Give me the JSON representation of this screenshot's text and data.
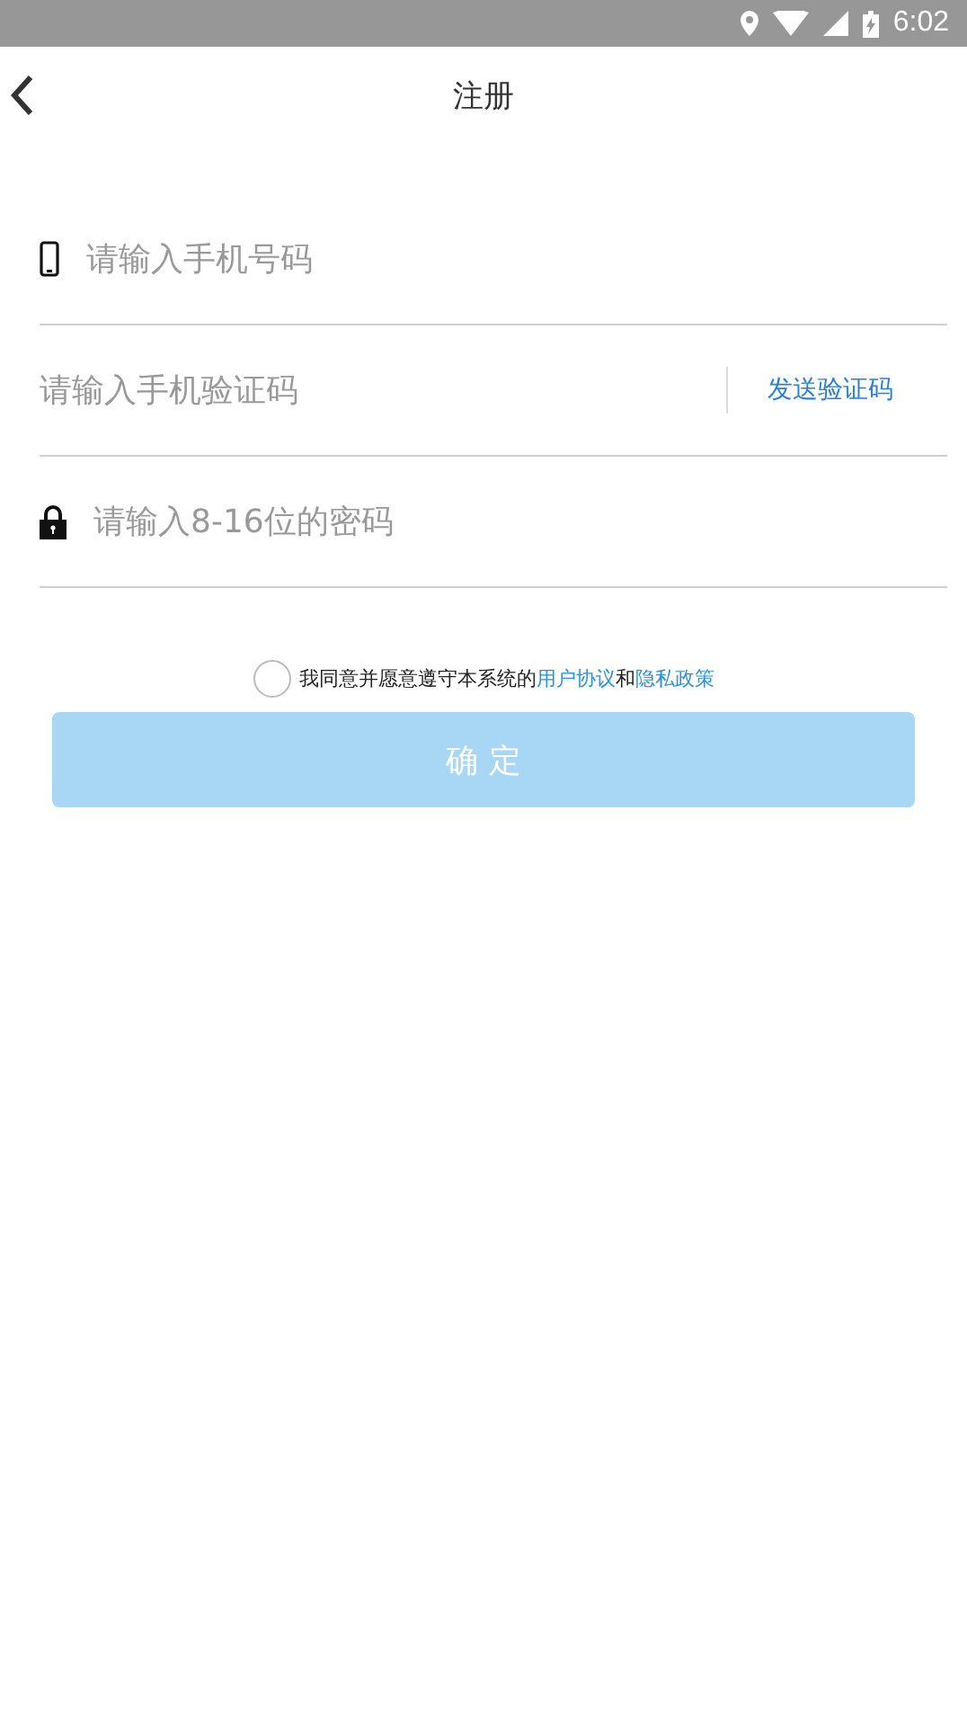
{
  "status_bar": {
    "time": "6:02"
  },
  "header": {
    "title": "注册"
  },
  "fields": [
    {
      "kind": "phone",
      "placeholder": "请输入手机号码"
    },
    {
      "kind": "code",
      "placeholder": "请输入手机验证码",
      "action": "发送验证码"
    },
    {
      "kind": "password",
      "placeholder": "请输入8-16位的密码"
    }
  ],
  "agreement": {
    "checked": false,
    "prefix": "我同意并愿意遵守本系统的",
    "link_1": "用户协议",
    "middle": "和",
    "link_2": "隐私政策"
  },
  "submit": {
    "label": "确 定",
    "disabled": true
  }
}
